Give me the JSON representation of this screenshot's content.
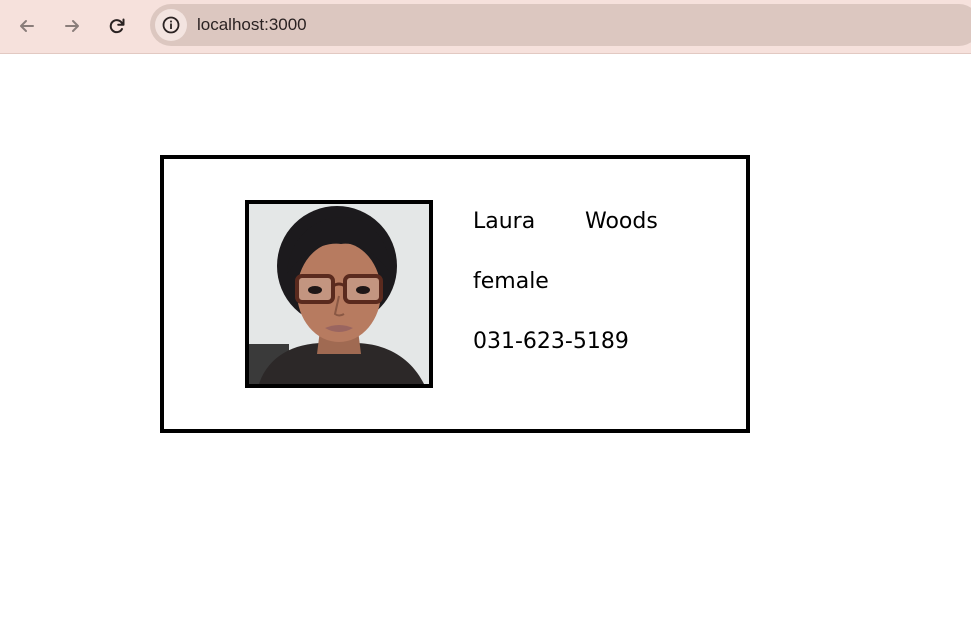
{
  "browser": {
    "url": "localhost:3000",
    "icons": {
      "back": "arrow-left-icon",
      "forward": "arrow-right-icon",
      "reload": "reload-icon",
      "site_info": "info-icon"
    }
  },
  "profile": {
    "first_name": "Laura",
    "last_name": "Woods",
    "gender": "female",
    "phone": "031-623-5189"
  }
}
